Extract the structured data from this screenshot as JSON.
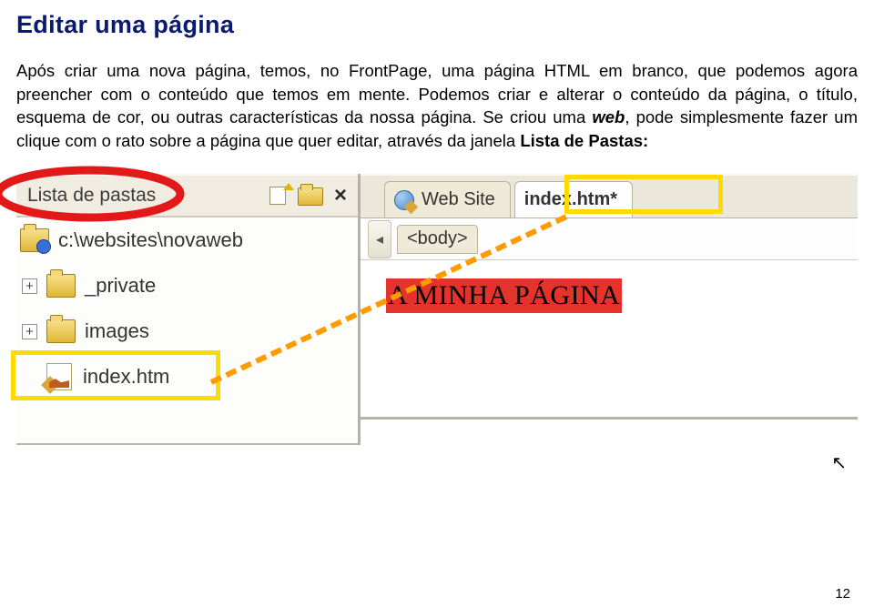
{
  "heading": "Editar uma página",
  "paragraph": {
    "p1": "Após criar uma nova página, temos, no FrontPage, uma página HTML em branco, que podemos agora preencher com o conteúdo que temos em mente. Podemos criar e alterar o conteúdo da página, o título, esquema de cor, ou outras características da nossa página. Se criou uma ",
    "web_emph": "web",
    "p2": ", pode simplesmente fazer um clique com o rato sobre a página que quer editar, através da janela ",
    "lista_bold": "Lista de Pastas:",
    "p3": ""
  },
  "panel": {
    "title": "Lista de pastas",
    "close": "×",
    "root": "c:\\websites\\novaweb",
    "items": [
      {
        "expander": "+",
        "label": "_private"
      },
      {
        "expander": "+",
        "label": "images"
      }
    ],
    "file": "index.htm"
  },
  "right": {
    "tab_web": "Web Site",
    "tab_index": "index.htm*",
    "body_tag": "<body>",
    "scroller_glyph": "◂",
    "page_title": "A MINHA PÁGINA"
  },
  "caret_glyph": "▷",
  "page_number": "12"
}
